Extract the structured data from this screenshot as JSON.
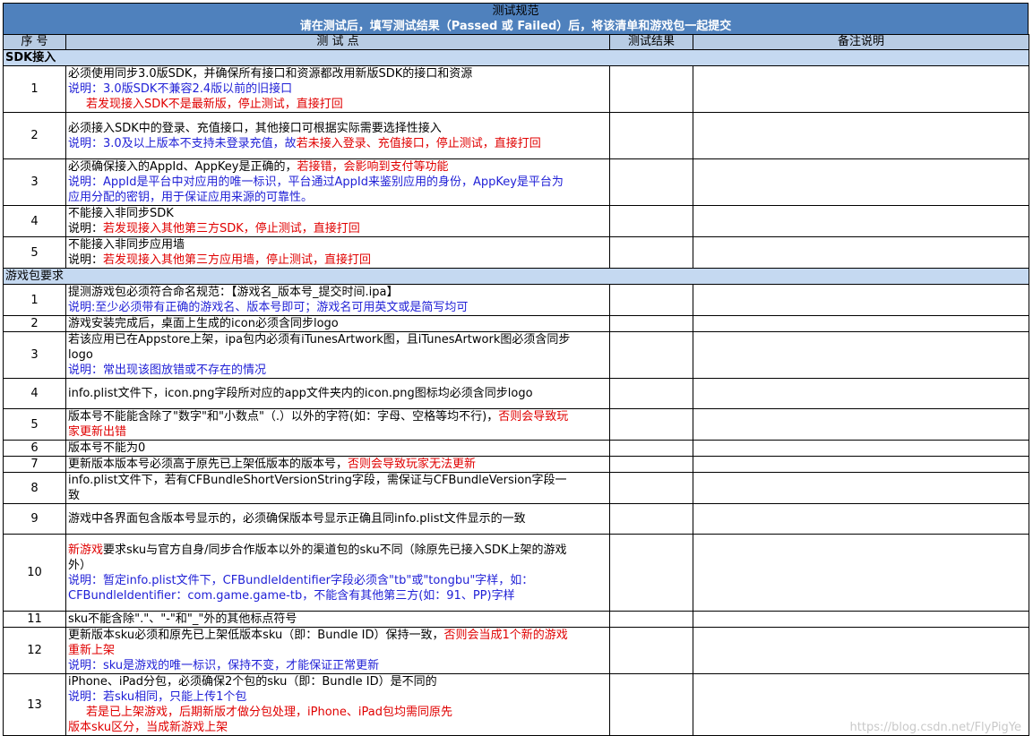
{
  "banner": {
    "title": "测试规范",
    "subtitle": "请在测试后，填写测试结果（Passed 或 Failed）后，将该清单和游戏包一起提交"
  },
  "headers": {
    "no": "序 号",
    "point": "测 试 点",
    "result": "测试结果",
    "remark": "备注说明"
  },
  "colors": {
    "banner": "#4f81bd",
    "header": "#b8cce4",
    "section": "#c5d9f1",
    "note_blue": "#1f1fd6",
    "warn_red": "#e00000"
  },
  "sections": [
    {
      "title": "SDK接入",
      "rows": [
        {
          "no": "1",
          "h": 50,
          "lines": [
            [
              {
                "t": "必须使用同步3.0版SDK，并确保所有接口和资源都改用新版SDK的接口和资源",
                "c": ""
              }
            ],
            [
              {
                "t": "说明：3.0版SDK不兼容2.4版以前的旧接口",
                "c": "blue"
              }
            ],
            [
              {
                "t": "若发现接入SDK不是最新版，停止测试，直接打回",
                "c": "red",
                "indent": true
              }
            ]
          ]
        },
        {
          "no": "2",
          "h": 52,
          "lines": [
            [
              {
                "t": "必须接入SDK中的登录、充值接口，其他接口可根据实际需要选择性接入",
                "c": ""
              }
            ],
            [
              {
                "t": "说明：3.0及以上版本不支持未登录充值，故",
                "c": "blue"
              },
              {
                "t": "若未接入登录、充值接口，停止测试，直接打回",
                "c": "red"
              }
            ]
          ]
        },
        {
          "no": "3",
          "h": 52,
          "lines": [
            [
              {
                "t": "必须确保接入的AppId、AppKey是正确的，",
                "c": ""
              },
              {
                "t": "若接错，会影响到支付等功能",
                "c": "red"
              }
            ],
            [
              {
                "t": "说明：AppId是平台中对应用的唯一标识，平台通过AppId来鉴别应用的身份，AppKey是平台为",
                "c": "blue"
              }
            ],
            [
              {
                "t": "应用分配的密钥，用于保证应用来源的可靠性。",
                "c": "blue"
              }
            ]
          ]
        },
        {
          "no": "4",
          "h": 34,
          "lines": [
            [
              {
                "t": "不能接入非同步SDK",
                "c": ""
              }
            ],
            [
              {
                "t": "说明：",
                "c": ""
              },
              {
                "t": "若发现接入其他第三方SDK，停止测试，直接打回",
                "c": "red"
              }
            ]
          ]
        },
        {
          "no": "5",
          "h": 34,
          "lines": [
            [
              {
                "t": "不能接入非同步应用墙",
                "c": ""
              }
            ],
            [
              {
                "t": "说明：",
                "c": ""
              },
              {
                "t": "若发现接入其他第三方应用墙，停止测试，直接打回",
                "c": "red"
              }
            ]
          ]
        }
      ]
    },
    {
      "title": "游戏包要求",
      "rows": [
        {
          "no": "1",
          "h": 34,
          "lines": [
            [
              {
                "t": "提测游戏包必须符合命名规范：【游戏名_版本号_提交时间.ipa】",
                "c": ""
              }
            ],
            [
              {
                "t": "说明:至少必须带有正确的游戏名、版本号即可；游戏名可用英文或是简写均可",
                "c": "blue"
              }
            ]
          ]
        },
        {
          "no": "2",
          "h": 17,
          "lines": [
            [
              {
                "t": "游戏安装完成后，桌面上生成的icon必须含同步logo",
                "c": ""
              }
            ]
          ]
        },
        {
          "no": "3",
          "h": 51,
          "lines": [
            [
              {
                "t": "若该应用已在Appstore上架，ipa包内必须有iTunesArtwork图，且iTunesArtwork图必须含同步",
                "c": ""
              }
            ],
            [
              {
                "t": "logo",
                "c": ""
              }
            ],
            [
              {
                "t": "说明：常出现该图放错或不存在的情况",
                "c": "blue"
              }
            ]
          ]
        },
        {
          "no": "4",
          "h": 34,
          "lines": [
            [
              {
                "t": "info.plist文件下，icon.png字段所对应的app文件夹内的icon.png图标均必须含同步logo",
                "c": ""
              }
            ]
          ]
        },
        {
          "no": "5",
          "h": 34,
          "lines": [
            [
              {
                "t": "版本号不能能含除了\"数字\"和\"小数点\"（.）以外的字符(如：字母、空格等均不行)，",
                "c": ""
              },
              {
                "t": "否则会导致玩",
                "c": "red"
              }
            ],
            [
              {
                "t": "家更新出错",
                "c": "red"
              }
            ]
          ]
        },
        {
          "no": "6",
          "h": 17,
          "lines": [
            [
              {
                "t": "版本号不能为0",
                "c": ""
              }
            ]
          ]
        },
        {
          "no": "7",
          "h": 17,
          "lines": [
            [
              {
                "t": "更新版本版本号必须高于原先已上架低版本的版本号，",
                "c": ""
              },
              {
                "t": "否则会导致玩家无法更新",
                "c": "red"
              }
            ]
          ]
        },
        {
          "no": "8",
          "h": 34,
          "lines": [
            [
              {
                "t": "info.plist文件下，若有CFBundleShortVersionString字段，需保证与CFBundleVersion字段一",
                "c": ""
              }
            ],
            [
              {
                "t": "致",
                "c": ""
              }
            ]
          ]
        },
        {
          "no": "9",
          "h": 34,
          "lines": [
            [
              {
                "t": "游戏中各界面包含版本号显示的，必须确保版本号显示正确且同info.plist文件显示的一致",
                "c": ""
              }
            ]
          ]
        },
        {
          "no": "10",
          "h": 86,
          "lines": [
            [
              {
                "t": "新游戏",
                "c": "red"
              },
              {
                "t": "要求sku与官方自身/同步合作版本以外的渠道包的sku不同（除原先已接入SDK上架的游戏",
                "c": ""
              }
            ],
            [
              {
                "t": "外）",
                "c": ""
              }
            ],
            [
              {
                "t": "说明：暂定info.plist文件下，CFBundleIdentifier字段必须含\"tb\"或\"tongbu\"字样，如：",
                "c": "blue"
              }
            ],
            [
              {
                "t": "CFBundleIdentifier：com.game.game-tb，不能含有其他第三方(如：91、PP)字样",
                "c": "blue"
              }
            ]
          ]
        },
        {
          "no": "11",
          "h": 17,
          "lines": [
            [
              {
                "t": "sku不能含除\".\"、\"-\"和\"_\"外的其他标点符号",
                "c": ""
              }
            ]
          ]
        },
        {
          "no": "12",
          "h": 52,
          "lines": [
            [
              {
                "t": "更新版本sku必须和原先已上架低版本sku（即：Bundle ID）保持一致，",
                "c": ""
              },
              {
                "t": "否则会当成1个新的游戏",
                "c": "red"
              }
            ],
            [
              {
                "t": "重新上架",
                "c": "red"
              }
            ],
            [
              {
                "t": "说明：sku是游戏的唯一标识，保持不变，才能保证正常更新",
                "c": "blue"
              }
            ]
          ]
        },
        {
          "no": "13",
          "h": 68,
          "lines": [
            [
              {
                "t": "iPhone、iPad分包，必须确保2个包的sku（即：Bundle ID）是不同的",
                "c": ""
              }
            ],
            [
              {
                "t": "说明：若sku相同，只能上传1个包",
                "c": "blue"
              }
            ],
            [
              {
                "t": "若是已上架游戏，后期新版才做分包处理，iPhone、iPad包均需同原先",
                "c": "red",
                "indent": true
              }
            ],
            [
              {
                "t": "版本sku区分，当成新游戏上架",
                "c": "red"
              }
            ]
          ]
        }
      ]
    }
  ],
  "watermark": "https://blog.csdn.net/FlyPigYe"
}
